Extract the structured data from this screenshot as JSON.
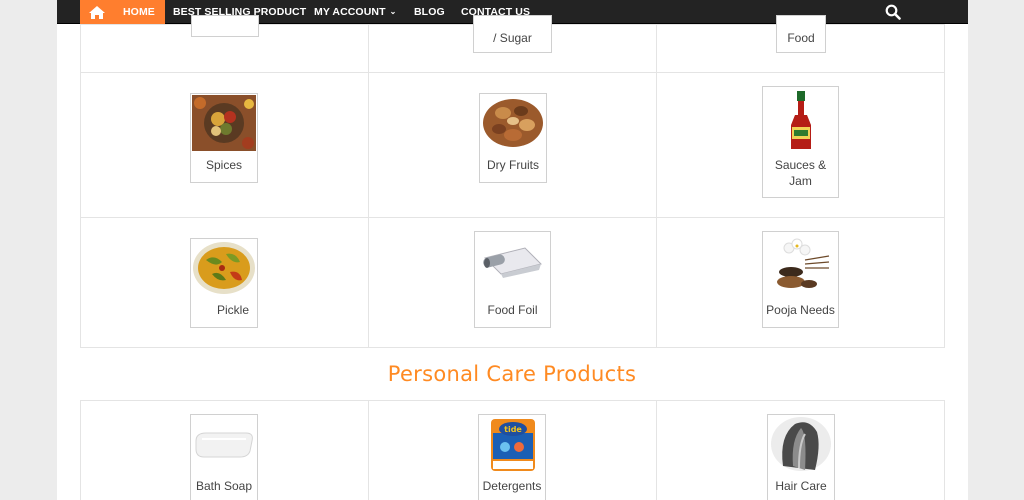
{
  "nav": {
    "home_label": "HOME",
    "items": [
      "BEST SELLING PRODUCT",
      "MY ACCOUNT",
      "BLOG",
      "CONTACT US"
    ],
    "active_color": "#ff7e2e",
    "bar_color": "#232323"
  },
  "top_row": {
    "col2_label": "/ Sugar",
    "col3_label": "Food"
  },
  "grocery": [
    {
      "label": "Spices",
      "icon": "spices-image"
    },
    {
      "label": "Dry Fruits",
      "icon": "dry-fruits-image"
    },
    {
      "label_line1": "Sauces &",
      "label_line2": "Jam",
      "icon": "sauce-bottle-image"
    },
    {
      "label": "Pickle",
      "icon": "pickle-image"
    },
    {
      "label": "Food Foil",
      "icon": "foil-roll-image"
    },
    {
      "label": "Pooja Needs",
      "icon": "pooja-items-image"
    }
  ],
  "section": {
    "title": "Personal Care Products",
    "title_color": "#ff8a22"
  },
  "personal_care": [
    {
      "label": "Bath Soap",
      "icon": "soap-image"
    },
    {
      "label": "Detergents",
      "icon": "detergent-pack-image"
    },
    {
      "label": "Hair Care",
      "icon": "hair-image"
    }
  ]
}
